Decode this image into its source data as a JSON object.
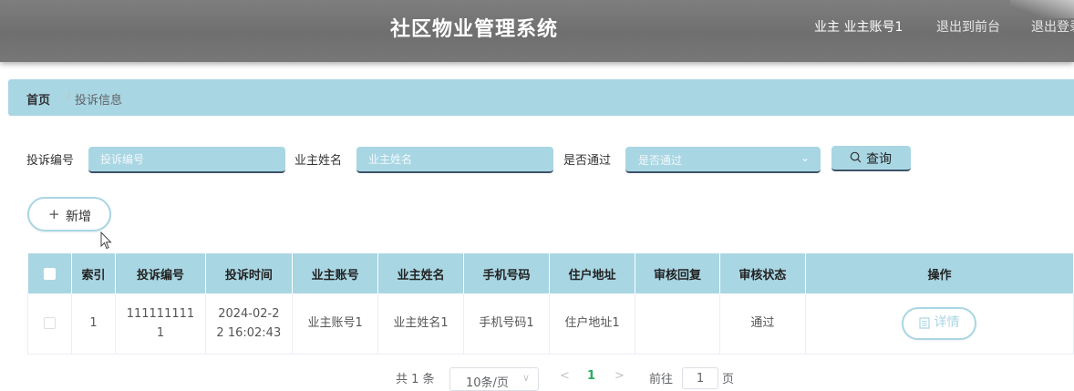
{
  "header": {
    "title": "社区物业管理系统",
    "user": "业主 业主账号1",
    "to_front": "退出到前台",
    "logout": "退出登录"
  },
  "breadcrumb": {
    "home": "首页",
    "separator": "/",
    "current": "投诉信息"
  },
  "search": {
    "complaint_no_label": "投诉编号",
    "complaint_no_placeholder": "投诉编号",
    "owner_name_label": "业主姓名",
    "owner_name_placeholder": "业主姓名",
    "passed_label": "是否通过",
    "passed_placeholder": "是否通过",
    "query_button": "查询"
  },
  "toolbar": {
    "add_button": "新增"
  },
  "table": {
    "headers": [
      "索引",
      "投诉编号",
      "投诉时间",
      "业主账号",
      "业主姓名",
      "手机号码",
      "住户地址",
      "审核回复",
      "审核状态",
      "操作"
    ],
    "rows": [
      {
        "index": "1",
        "complaint_no_line1": "111111111",
        "complaint_no_line2": "1",
        "time_line1": "2024-02-2",
        "time_line2": "2 16:02:43",
        "owner_account": "业主账号1",
        "owner_name": "业主姓名1",
        "phone": "手机号码1",
        "address": "住户地址1",
        "review_reply": "",
        "review_status": "通过",
        "detail_button": "详情"
      }
    ]
  },
  "pagination": {
    "total": "共 1 条",
    "page_size": "10条/页",
    "prev": "<",
    "current_page": "1",
    "next": ">",
    "goto_prefix": "前往",
    "goto_value": "1",
    "goto_suffix": "页"
  },
  "colors": {
    "accent": "#a9d6e3",
    "header_bg": "#777777",
    "active_page": "#27ae60"
  }
}
